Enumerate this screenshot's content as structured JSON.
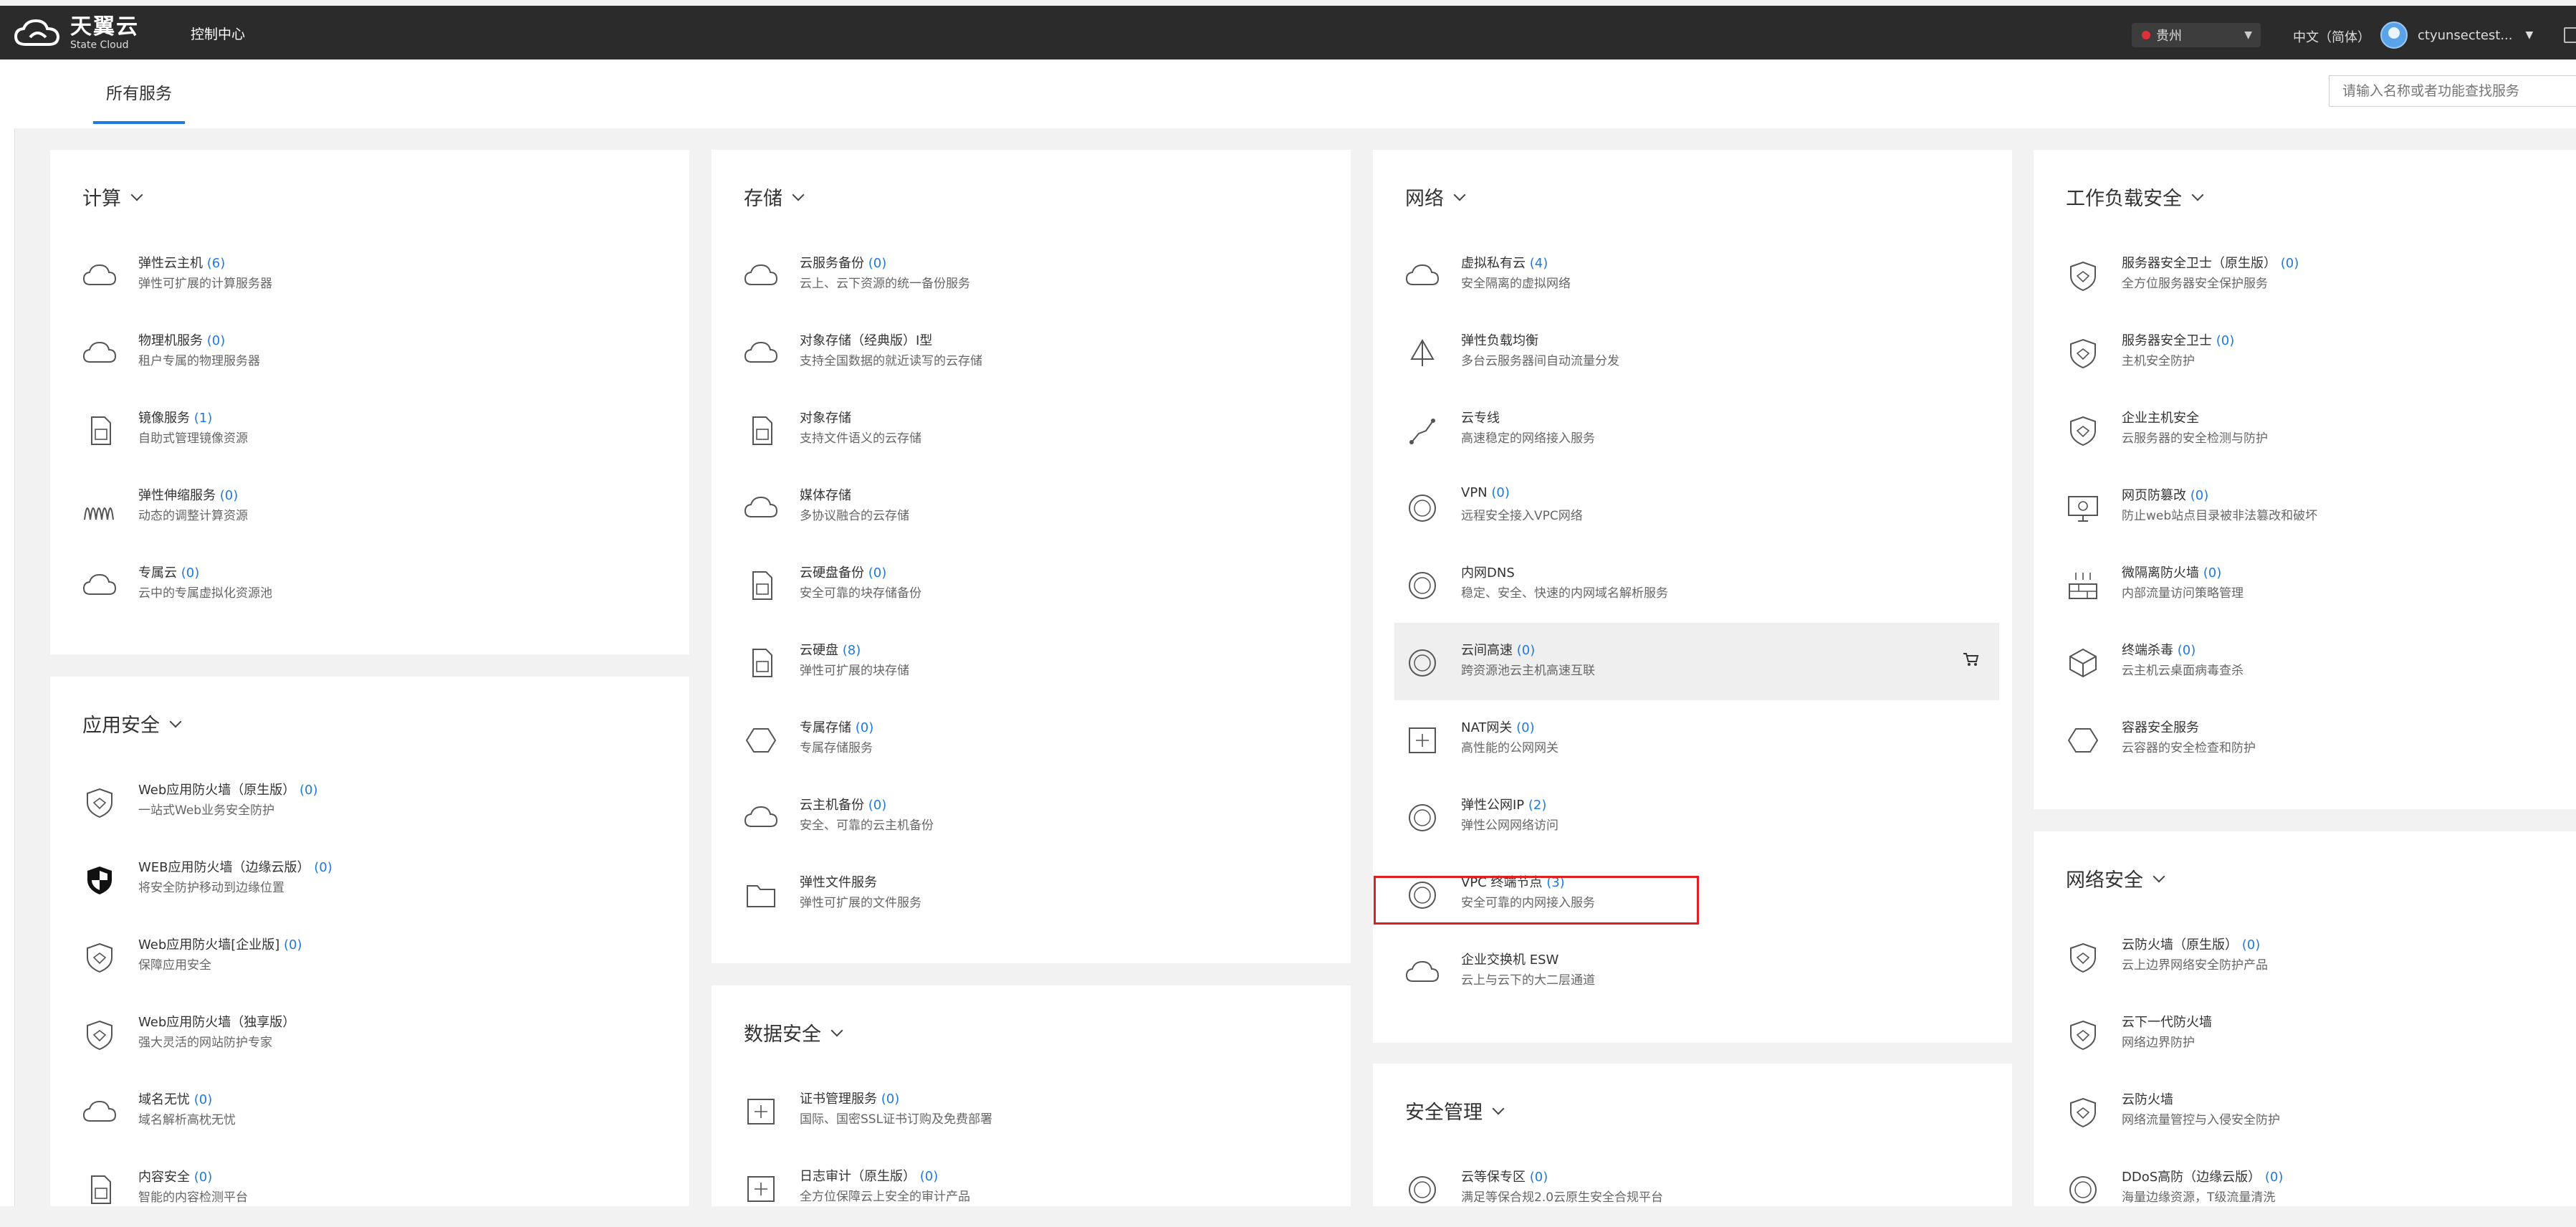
{
  "header": {
    "logo_cn": "天翼云",
    "logo_en": "State Cloud",
    "console": "控制中心",
    "region": "贵州",
    "language": "中文（简体）",
    "user": "ctyunsectest..."
  },
  "subheader": {
    "tab": "所有服务",
    "search_placeholder": "请输入名称或者功能查找服务"
  },
  "cards": {
    "compute": {
      "title": "计算",
      "items": [
        {
          "name": "弹性云主机",
          "count": "(6)",
          "desc": "弹性可扩展的计算服务器"
        },
        {
          "name": "物理机服务",
          "count": "(0)",
          "desc": "租户专属的物理服务器"
        },
        {
          "name": "镜像服务",
          "count": "(1)",
          "desc": "自助式管理镜像资源"
        },
        {
          "name": "弹性伸缩服务",
          "count": "(0)",
          "desc": "动态的调整计算资源"
        },
        {
          "name": "专属云",
          "count": "(0)",
          "desc": "云中的专属虚拟化资源池"
        }
      ]
    },
    "appsec": {
      "title": "应用安全",
      "items": [
        {
          "name": "Web应用防火墙（原生版）",
          "count": "(0)",
          "desc": "一站式Web业务安全防护"
        },
        {
          "name": "WEB应用防火墙（边缘云版）",
          "count": "(0)",
          "desc": "将安全防护移动到边缘位置"
        },
        {
          "name": "Web应用防火墙[企业版]",
          "count": "(0)",
          "desc": "保障应用安全"
        },
        {
          "name": "Web应用防火墙（独享版）",
          "count": "",
          "desc": "强大灵活的网站防护专家"
        },
        {
          "name": "域名无忧",
          "count": "(0)",
          "desc": "域名解析高枕无忧"
        },
        {
          "name": "内容安全",
          "count": "(0)",
          "desc": "智能的内容检测平台"
        }
      ]
    },
    "storage": {
      "title": "存储",
      "items": [
        {
          "name": "云服务备份",
          "count": "(0)",
          "desc": "云上、云下资源的统一备份服务"
        },
        {
          "name": "对象存储（经典版）Ⅰ型",
          "count": "",
          "desc": "支持全国数据的就近读写的云存储"
        },
        {
          "name": "对象存储",
          "count": "",
          "desc": "支持文件语义的云存储"
        },
        {
          "name": "媒体存储",
          "count": "",
          "desc": "多协议融合的云存储"
        },
        {
          "name": "云硬盘备份",
          "count": "(0)",
          "desc": "安全可靠的块存储备份"
        },
        {
          "name": "云硬盘",
          "count": "(8)",
          "desc": "弹性可扩展的块存储"
        },
        {
          "name": "专属存储",
          "count": "(0)",
          "desc": "专属存储服务"
        },
        {
          "name": "云主机备份",
          "count": "(0)",
          "desc": "安全、可靠的云主机备份"
        },
        {
          "name": "弹性文件服务",
          "count": "",
          "desc": "弹性可扩展的文件服务"
        }
      ]
    },
    "datasec": {
      "title": "数据安全",
      "items": [
        {
          "name": "证书管理服务",
          "count": "(0)",
          "desc": "国际、国密SSL证书订购及免费部署"
        },
        {
          "name": "日志审计（原生版）",
          "count": "(0)",
          "desc": "全方位保障云上安全的审计产品"
        }
      ]
    },
    "network": {
      "title": "网络",
      "items": [
        {
          "name": "虚拟私有云",
          "count": "(4)",
          "desc": "安全隔离的虚拟网络"
        },
        {
          "name": "弹性负载均衡",
          "count": "",
          "desc": "多台云服务器间自动流量分发"
        },
        {
          "name": "云专线",
          "count": "",
          "desc": "高速稳定的网络接入服务"
        },
        {
          "name": "VPN",
          "count": "(0)",
          "desc": "远程安全接入VPC网络"
        },
        {
          "name": "内网DNS",
          "count": "",
          "desc": "稳定、安全、快速的内网域名解析服务"
        },
        {
          "name": "云间高速",
          "count": "(0)",
          "desc": "跨资源池云主机高速互联"
        },
        {
          "name": "NAT网关",
          "count": "(0)",
          "desc": "高性能的公网网关"
        },
        {
          "name": "弹性公网IP",
          "count": "(2)",
          "desc": "弹性公网网络访问"
        },
        {
          "name": "VPC 终端节点",
          "count": "(3)",
          "desc": "安全可靠的内网接入服务"
        },
        {
          "name": "企业交换机 ESW",
          "count": "",
          "desc": "云上与云下的大二层通道"
        }
      ]
    },
    "secmgmt": {
      "title": "安全管理",
      "items": [
        {
          "name": "云等保专区",
          "count": "(0)",
          "desc": "满足等保合规2.0云原生安全合规平台"
        }
      ]
    },
    "workload": {
      "title": "工作负载安全",
      "items": [
        {
          "name": "服务器安全卫士（原生版）",
          "count": "(0)",
          "desc": "全方位服务器安全保护服务"
        },
        {
          "name": "服务器安全卫士",
          "count": "(0)",
          "desc": "主机安全防护"
        },
        {
          "name": "企业主机安全",
          "count": "",
          "desc": "云服务器的安全检测与防护"
        },
        {
          "name": "网页防篡改",
          "count": "(0)",
          "desc": "防止web站点目录被非法篡改和破坏"
        },
        {
          "name": "微隔离防火墙",
          "count": "(0)",
          "desc": "内部流量访问策略管理"
        },
        {
          "name": "终端杀毒",
          "count": "(0)",
          "desc": "云主机云桌面病毒查杀"
        },
        {
          "name": "容器安全服务",
          "count": "",
          "desc": "云容器的安全检查和防护"
        }
      ]
    },
    "netsec": {
      "title": "网络安全",
      "items": [
        {
          "name": "云防火墙（原生版）",
          "count": "(0)",
          "desc": "云上边界网络安全防护产品"
        },
        {
          "name": "云下一代防火墙",
          "count": "",
          "desc": "网络边界防护"
        },
        {
          "name": "云防火墙",
          "count": "",
          "desc": "网络流量管控与入侵安全防护"
        },
        {
          "name": "DDoS高防（边缘云版）",
          "count": "(0)",
          "desc": "海量边缘资源，T级流量清洗"
        }
      ]
    }
  },
  "colors": {
    "accent": "#1f7ae0",
    "topbar": "#2b2b2b",
    "highlight": "#e02020"
  },
  "icons": {
    "compute": [
      "cloud-server-icon",
      "cloud-server-icon",
      "image-file-icon",
      "autoscale-icon",
      "cloud-icon"
    ],
    "appsec": [
      "shield-icon",
      "shield-filled-icon",
      "shield-icon",
      "shield-icon",
      "domain-icon",
      "content-safety-icon"
    ],
    "storage": [
      "backup-icon",
      "object-storage-icon",
      "file-icon",
      "media-storage-icon",
      "disk-backup-icon",
      "disk-icon",
      "hexagon-icon",
      "host-backup-icon",
      "folder-icon"
    ],
    "datasec": [
      "certificate-icon",
      "log-audit-icon"
    ],
    "network": [
      "vpc-icon",
      "load-balancer-icon",
      "direct-connect-icon",
      "vpn-icon",
      "dns-icon",
      "cloud-link-icon",
      "nat-icon",
      "ip-icon",
      "endpoint-icon",
      "switch-icon"
    ],
    "secmgmt": [
      "compliance-icon"
    ],
    "workload": [
      "server-guard-icon",
      "server-guard-icon",
      "host-security-icon",
      "web-tamper-icon",
      "micro-firewall-icon",
      "antivirus-icon",
      "container-icon"
    ],
    "netsec": [
      "firewall-icon",
      "firewall-icon",
      "firewall-icon",
      "ddos-icon"
    ]
  }
}
